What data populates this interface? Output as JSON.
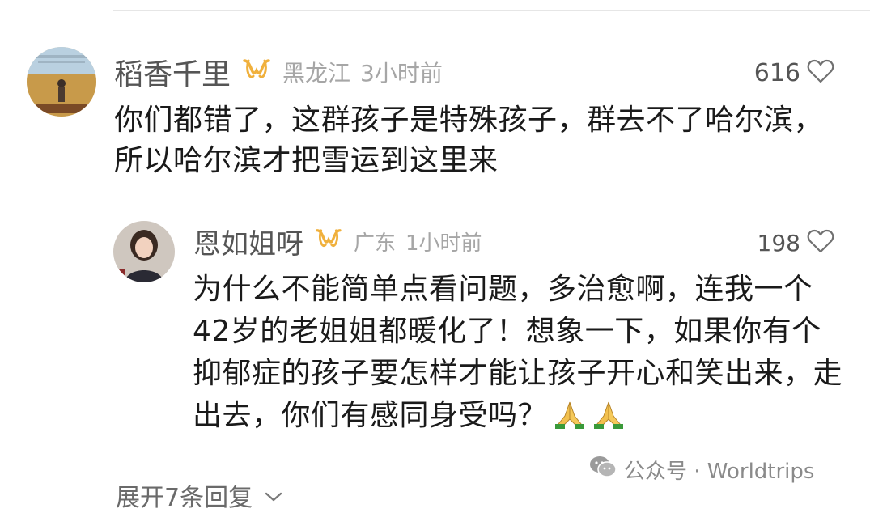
{
  "comments": [
    {
      "username": "稻香千里",
      "location": "黑龙江",
      "time": "3小时前",
      "likes": "616",
      "content": "你们都错了，这群孩子是特殊孩子，群去不了哈尔滨，所以哈尔滨才把雪运到这里来"
    },
    {
      "username": "恩如姐呀",
      "location": "广东",
      "time": "1小时前",
      "likes": "198",
      "content": "为什么不能简单点看问题，多治愈啊，连我一个42岁的老姐姐都暖化了！想象一下，如果你有个抑郁症的孩子要怎样才能让孩子开心和笑出来，走出去，你们有感同身受吗？"
    }
  ],
  "expand_replies": "展开7条回复",
  "watermark": "公众号 · Worldtrips",
  "colors": {
    "vip": "#f0b03c",
    "meta": "#a6a6a6",
    "text": "#1a1a1a"
  }
}
